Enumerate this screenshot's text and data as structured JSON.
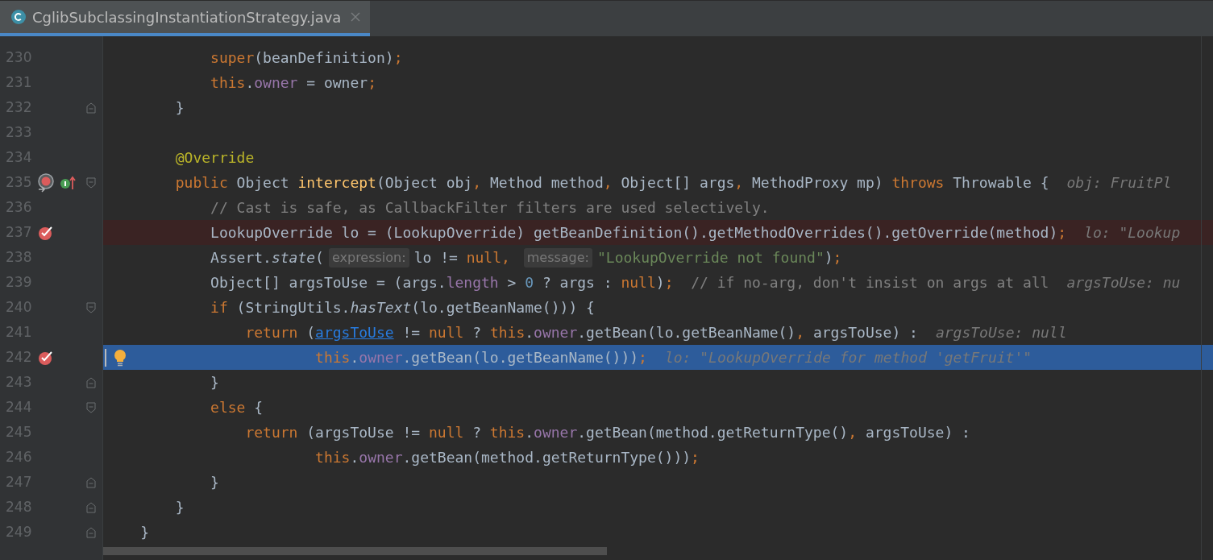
{
  "tab": {
    "title": "CglibSubclassingInstantiationStrategy.java",
    "selected": true
  },
  "lines": [
    {
      "number": "230",
      "kind": "normal",
      "segments": [
        {
          "kind": "code",
          "tokens": [
            {
              "kind": "keyword",
              "text": "            super"
            },
            {
              "kind": "plain",
              "text": "(beanDefinition)"
            },
            {
              "kind": "keyword",
              "text": ";"
            }
          ]
        }
      ]
    },
    {
      "number": "231",
      "kind": "normal",
      "segments": [
        {
          "kind": "code",
          "tokens": [
            {
              "kind": "keyword",
              "text": "            this"
            },
            {
              "kind": "plain",
              "text": "."
            },
            {
              "kind": "field",
              "text": "owner"
            },
            {
              "kind": "plain",
              "text": " = owner"
            },
            {
              "kind": "keyword",
              "text": ";"
            }
          ]
        }
      ]
    },
    {
      "number": "232",
      "kind": "normal",
      "icons": [
        {
          "kind": "fold_end"
        }
      ],
      "segments": [
        {
          "kind": "code",
          "tokens": [
            {
              "kind": "plain",
              "text": "        }"
            }
          ]
        }
      ]
    },
    {
      "number": "233",
      "kind": "normal"
    },
    {
      "number": "234",
      "kind": "normal",
      "segments": [
        {
          "kind": "code",
          "tokens": [
            {
              "kind": "annotation",
              "text": "        @Override"
            }
          ]
        }
      ]
    },
    {
      "number": "235",
      "kind": "normal",
      "icons": [
        {
          "kind": "method_breakpoint"
        },
        {
          "kind": "implements"
        },
        {
          "kind": "fold_start"
        }
      ],
      "segments": [
        {
          "kind": "code",
          "tokens": [
            {
              "kind": "keyword",
              "text": "        public "
            },
            {
              "kind": "plain",
              "text": "Object "
            },
            {
              "kind": "declaration",
              "text": "intercept"
            },
            {
              "kind": "plain",
              "text": "(Object obj"
            },
            {
              "kind": "keyword",
              "text": ", "
            },
            {
              "kind": "plain",
              "text": "Method method"
            },
            {
              "kind": "keyword",
              "text": ", "
            },
            {
              "kind": "plain",
              "text": "Object[] args"
            },
            {
              "kind": "keyword",
              "text": ", "
            },
            {
              "kind": "plain",
              "text": "MethodProxy mp) "
            },
            {
              "kind": "keyword",
              "text": "throws "
            },
            {
              "kind": "plain",
              "text": "Throwable {"
            }
          ]
        },
        {
          "kind": "value",
          "text": "obj: FruitPl"
        }
      ]
    },
    {
      "number": "236",
      "kind": "normal",
      "segments": [
        {
          "kind": "code",
          "tokens": [
            {
              "kind": "comment",
              "text": "            // Cast is safe, as CallbackFilter filters are used selectively."
            }
          ]
        }
      ]
    },
    {
      "number": "237",
      "kind": "breakpoint",
      "icons": [
        {
          "kind": "line_breakpoint"
        }
      ],
      "segments": [
        {
          "kind": "code",
          "tokens": [
            {
              "kind": "plain",
              "text": "            LookupOverride lo = (LookupOverride) getBeanDefinition().getMethodOverrides().getOverride(method)"
            },
            {
              "kind": "keyword",
              "text": ";"
            }
          ]
        },
        {
          "kind": "value",
          "text": "lo: \"Lookup"
        }
      ]
    },
    {
      "number": "238",
      "kind": "normal",
      "segments": [
        {
          "kind": "code",
          "tokens": [
            {
              "kind": "plain",
              "text": "            Assert."
            },
            {
              "kind": "static",
              "text": "state"
            },
            {
              "kind": "plain",
              "text": "("
            }
          ]
        },
        {
          "kind": "hint",
          "text": "expression:"
        },
        {
          "kind": "code",
          "tokens": [
            {
              "kind": "plain",
              "text": "lo != "
            },
            {
              "kind": "keyword",
              "text": "null, "
            }
          ]
        },
        {
          "kind": "hint",
          "text": "message:"
        },
        {
          "kind": "code",
          "tokens": [
            {
              "kind": "string",
              "text": "\"LookupOverride not found\""
            },
            {
              "kind": "plain",
              "text": ")"
            },
            {
              "kind": "keyword",
              "text": ";"
            }
          ]
        }
      ]
    },
    {
      "number": "239",
      "kind": "normal",
      "segments": [
        {
          "kind": "code",
          "tokens": [
            {
              "kind": "plain",
              "text": "            Object[] argsToUse = (args."
            },
            {
              "kind": "field",
              "text": "length"
            },
            {
              "kind": "plain",
              "text": " > "
            },
            {
              "kind": "number",
              "text": "0"
            },
            {
              "kind": "plain",
              "text": " ? args : "
            },
            {
              "kind": "keyword",
              "text": "null"
            },
            {
              "kind": "plain",
              "text": ")"
            },
            {
              "kind": "keyword",
              "text": ";  "
            },
            {
              "kind": "comment",
              "text": "// if no-arg, don't insist on args at all"
            }
          ]
        },
        {
          "kind": "value",
          "text": "argsToUse: nu"
        }
      ]
    },
    {
      "number": "240",
      "kind": "normal",
      "icons": [
        {
          "kind": "fold_start"
        }
      ],
      "segments": [
        {
          "kind": "code",
          "tokens": [
            {
              "kind": "keyword",
              "text": "            if "
            },
            {
              "kind": "plain",
              "text": "(StringUtils."
            },
            {
              "kind": "static",
              "text": "hasText"
            },
            {
              "kind": "plain",
              "text": "(lo.getBeanName())) {"
            }
          ]
        }
      ]
    },
    {
      "number": "241",
      "kind": "normal",
      "segments": [
        {
          "kind": "code",
          "tokens": [
            {
              "kind": "keyword",
              "text": "                return "
            },
            {
              "kind": "plain",
              "text": "("
            },
            {
              "kind": "link",
              "text": "argsToUse"
            },
            {
              "kind": "plain",
              "text": " != "
            },
            {
              "kind": "keyword",
              "text": "null "
            },
            {
              "kind": "plain",
              "text": "? "
            },
            {
              "kind": "keyword",
              "text": "this"
            },
            {
              "kind": "plain",
              "text": "."
            },
            {
              "kind": "field",
              "text": "owner"
            },
            {
              "kind": "plain",
              "text": ".getBean(lo.getBeanName()"
            },
            {
              "kind": "keyword",
              "text": ", "
            },
            {
              "kind": "plain",
              "text": "argsToUse) :"
            }
          ]
        },
        {
          "kind": "value",
          "text": "argsToUse: null"
        }
      ]
    },
    {
      "number": "242",
      "kind": "execution",
      "icons": [
        {
          "kind": "line_breakpoint"
        },
        {
          "kind": "intention_bulb"
        }
      ],
      "segments": [
        {
          "kind": "code",
          "tokens": [
            {
              "kind": "keyword",
              "text": "                        this"
            },
            {
              "kind": "plain",
              "text": "."
            },
            {
              "kind": "field",
              "text": "owner"
            },
            {
              "kind": "plain",
              "text": ".getBean(lo.getBeanName()))"
            },
            {
              "kind": "keyword",
              "text": ";"
            }
          ]
        },
        {
          "kind": "value",
          "text": "lo: \"LookupOverride for method 'getFruit'\""
        }
      ]
    },
    {
      "number": "243",
      "kind": "normal",
      "icons": [
        {
          "kind": "fold_end"
        }
      ],
      "segments": [
        {
          "kind": "code",
          "tokens": [
            {
              "kind": "plain",
              "text": "            }"
            }
          ]
        }
      ]
    },
    {
      "number": "244",
      "kind": "normal",
      "icons": [
        {
          "kind": "fold_start"
        }
      ],
      "segments": [
        {
          "kind": "code",
          "tokens": [
            {
              "kind": "keyword",
              "text": "            else "
            },
            {
              "kind": "plain",
              "text": "{"
            }
          ]
        }
      ]
    },
    {
      "number": "245",
      "kind": "normal",
      "segments": [
        {
          "kind": "code",
          "tokens": [
            {
              "kind": "keyword",
              "text": "                return "
            },
            {
              "kind": "plain",
              "text": "(argsToUse != "
            },
            {
              "kind": "keyword",
              "text": "null "
            },
            {
              "kind": "plain",
              "text": "? "
            },
            {
              "kind": "keyword",
              "text": "this"
            },
            {
              "kind": "plain",
              "text": "."
            },
            {
              "kind": "field",
              "text": "owner"
            },
            {
              "kind": "plain",
              "text": ".getBean(method.getReturnType()"
            },
            {
              "kind": "keyword",
              "text": ", "
            },
            {
              "kind": "plain",
              "text": "argsToUse) :"
            }
          ]
        }
      ]
    },
    {
      "number": "246",
      "kind": "normal",
      "segments": [
        {
          "kind": "code",
          "tokens": [
            {
              "kind": "keyword",
              "text": "                        this"
            },
            {
              "kind": "plain",
              "text": "."
            },
            {
              "kind": "field",
              "text": "owner"
            },
            {
              "kind": "plain",
              "text": ".getBean(method.getReturnType()))"
            },
            {
              "kind": "keyword",
              "text": ";"
            }
          ]
        }
      ]
    },
    {
      "number": "247",
      "kind": "normal",
      "icons": [
        {
          "kind": "fold_end"
        }
      ],
      "segments": [
        {
          "kind": "code",
          "tokens": [
            {
              "kind": "plain",
              "text": "            }"
            }
          ]
        }
      ]
    },
    {
      "number": "248",
      "kind": "normal",
      "icons": [
        {
          "kind": "fold_end"
        }
      ],
      "segments": [
        {
          "kind": "code",
          "tokens": [
            {
              "kind": "plain",
              "text": "        }"
            }
          ]
        }
      ]
    },
    {
      "number": "249",
      "kind": "normal",
      "icons": [
        {
          "kind": "fold_end"
        }
      ],
      "segments": [
        {
          "kind": "code",
          "tokens": [
            {
              "kind": "plain",
              "text": "    }"
            }
          ]
        }
      ]
    }
  ]
}
